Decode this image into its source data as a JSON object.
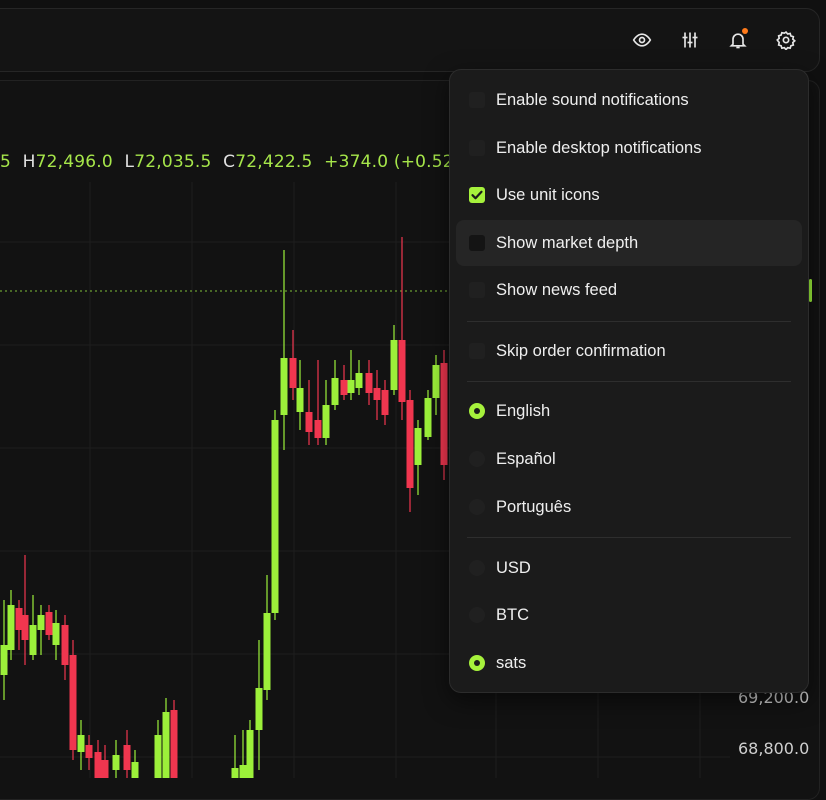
{
  "ohlc": {
    "h_label": "H",
    "h_value": "72,496.0",
    "l_label": "L",
    "l_value": "72,035.5",
    "c_label": "C",
    "c_value": "72,422.5",
    "change": "+374.0 (+0.52",
    "lead": "5"
  },
  "y_axis": {
    "labels": [
      "69,200.0",
      "68,800.0"
    ]
  },
  "icons": {
    "visibility": "eye-icon",
    "layout": "sliders-icon",
    "notifications": "bell-icon",
    "settings": "gear-icon"
  },
  "colors": {
    "accent": "#a6f13c",
    "up": "#9cf03a",
    "down": "#f0364f",
    "notification_dot": "#ff7a1a"
  },
  "settings_menu": {
    "toggles": [
      {
        "label": "Enable sound notifications",
        "checked": false
      },
      {
        "label": "Enable desktop notifications",
        "checked": false
      },
      {
        "label": "Use unit icons",
        "checked": true
      },
      {
        "label": "Show market depth",
        "checked": false
      },
      {
        "label": "Show news feed",
        "checked": false
      },
      {
        "label": "Skip order confirmation",
        "checked": false
      }
    ],
    "languages": [
      {
        "label": "English",
        "selected": true
      },
      {
        "label": "Español",
        "selected": false
      },
      {
        "label": "Português",
        "selected": false
      }
    ],
    "units": [
      {
        "label": "USD",
        "selected": false
      },
      {
        "label": "BTC",
        "selected": false
      },
      {
        "label": "sats",
        "selected": true
      }
    ]
  }
}
